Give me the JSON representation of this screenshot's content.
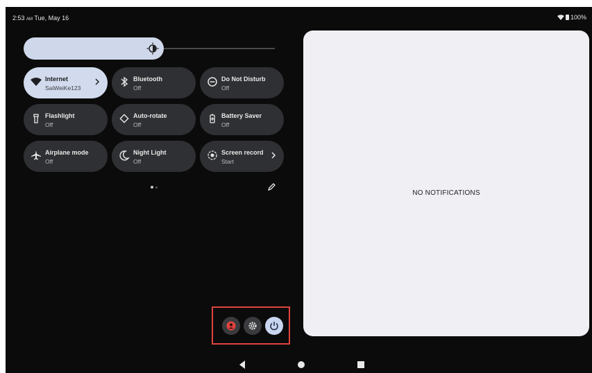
{
  "status_bar": {
    "time": "2:53",
    "ampm": "AM",
    "date": "Tue, May 16",
    "battery": "100%"
  },
  "brightness": {
    "level": 0.55
  },
  "tiles": [
    {
      "label": "Internet",
      "sub": "SaiWeiKe123",
      "icon": "wifi-icon",
      "active": true,
      "chevron": true
    },
    {
      "label": "Bluetooth",
      "sub": "Off",
      "icon": "bluetooth-icon",
      "active": false,
      "chevron": false
    },
    {
      "label": "Do Not Disturb",
      "sub": "Off",
      "icon": "do-not-disturb-icon",
      "active": false,
      "chevron": false
    },
    {
      "label": "Flashlight",
      "sub": "Off",
      "icon": "flashlight-icon",
      "active": false,
      "chevron": false
    },
    {
      "label": "Auto-rotate",
      "sub": "Off",
      "icon": "auto-rotate-icon",
      "active": false,
      "chevron": false
    },
    {
      "label": "Battery Saver",
      "sub": "Off",
      "icon": "battery-saver-icon",
      "active": false,
      "chevron": false
    },
    {
      "label": "Airplane mode",
      "sub": "Off",
      "icon": "airplane-icon",
      "active": false,
      "chevron": false
    },
    {
      "label": "Night Light",
      "sub": "Off",
      "icon": "night-light-icon",
      "active": false,
      "chevron": false
    },
    {
      "label": "Screen record",
      "sub": "Start",
      "icon": "screen-record-icon",
      "active": false,
      "chevron": true
    }
  ],
  "notifications": {
    "empty_text": "NO NOTIFICATIONS"
  },
  "footer_buttons": [
    "user-icon",
    "settings-icon",
    "power-icon"
  ],
  "colors": {
    "background": "#0b0b0b",
    "tile": "#2f3033",
    "tile_active": "#d2dbee",
    "panel": "#f0eff3",
    "highlight": "#e0443e"
  }
}
